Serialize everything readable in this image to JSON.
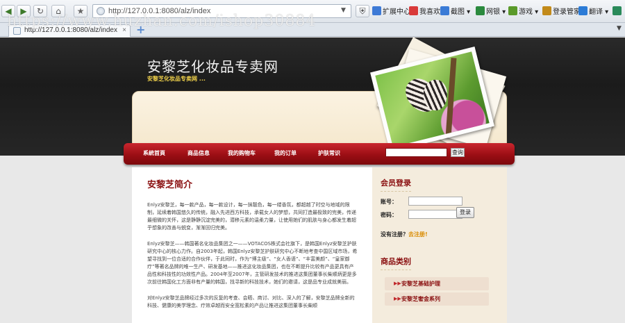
{
  "browser": {
    "address": "http://127.0.0.1:8080/alz/index",
    "tab_title": "http://127.0.0.1:8080/alz/index",
    "tab_close": "×",
    "new_tab": "+",
    "nav_back": "◀",
    "nav_forward": "▶",
    "nav_refresh": "↻",
    "nav_home": "⌂",
    "nav_star": "★",
    "toolbar_items": [
      {
        "label": "扩展中心",
        "icon": "extension-icon",
        "color": "#3d7ad6"
      },
      {
        "label": "我喜欢",
        "icon": "heart-icon",
        "color": "#d93a3a"
      },
      {
        "label": "截图",
        "icon": "scissors-icon",
        "color": "#3a7bd6"
      },
      {
        "label": "网银",
        "icon": "bank-icon",
        "color": "#2b8a3e"
      },
      {
        "label": "游戏",
        "icon": "gamepad-icon",
        "color": "#5a9a2a"
      },
      {
        "label": "登录管家",
        "icon": "key-icon",
        "color": "#c28a1a"
      },
      {
        "label": "翻译",
        "icon": "translate-icon",
        "color": "#2b7bd6"
      }
    ]
  },
  "watermark": "https://www.huzhan.com/ishop30884",
  "site": {
    "title": "安黎芝化妆品专卖网",
    "subtitle": "安黎芝化妆品专卖网 ..."
  },
  "nav": {
    "items": [
      "系統首頁",
      "商品信息",
      "我的购物车",
      "我的订单",
      "护肤常识"
    ],
    "search_button": "查询"
  },
  "main": {
    "title": "安黎芝简介",
    "paragraphs": [
      "Enlyz安黎芝，每一款产品，每一款设计，每一抹靓色，每一缕香氛，都超越了时空与地域的限制，延续着韩国悠久的传统，融入先进西方科技，承载女人的梦想，共同打造最极致的完美，传递最细微的关怀，这是静静沉淀完美的，潜移元素的温柔力量，让使用她们的肌肤与身心都发生着超乎想象的改善与蜕变，渐渐回归完美。",
      "Enlyz安黎芝——韩国著名化妆品集团之一——VOTACOS株式会社旗下，是韩国Enlyz安黎芝护肤研究中心的核心力作。自2003年起，韩国Enlyz安黎芝护肤研究中心不断地考查中国区域市场，希望寻找到一位合适的合作伙伴，于此同时，作为“博主级”、“女人香语”、“丰富美颜”、“皇家御疗”等著名品牌的唯一生产、研发基地——推进这化妆品集团，也在不断提升比较有产品更具有产品性和科技性的功效性产品。2004年至2007年，主管研发技术的推进这集团董事长柴顺炳更是多次前往韩国化工方面非有产量的韩国，找寻新的科技技术，她们的邀请，这是品专业成就美丽。",
      "对Enlyz安黎芝品牌经过多次的反复的考查、会晤、商讨、对比、深入的了解，安黎芝品牌全新的科技、健康的美学理念、疗效卓越而安全宽松素的产品让推进这集团董事长柴顺"
    ]
  },
  "sidebar": {
    "login_title": "会员登录",
    "account_label": "账号：",
    "password_label": "密码：",
    "login_button": "登录",
    "register_prompt": "没有注册？",
    "register_link": "去注册!",
    "category_title": "商品类别",
    "categories": [
      "安黎芝基础护理",
      "安黎芝奢金系列"
    ]
  },
  "colors": {
    "accent_red": "#9b0e14",
    "title_red": "#8a0f10",
    "subtitle_yellow": "#f2d34b",
    "sidebar_bg": "#f4ecdd"
  }
}
